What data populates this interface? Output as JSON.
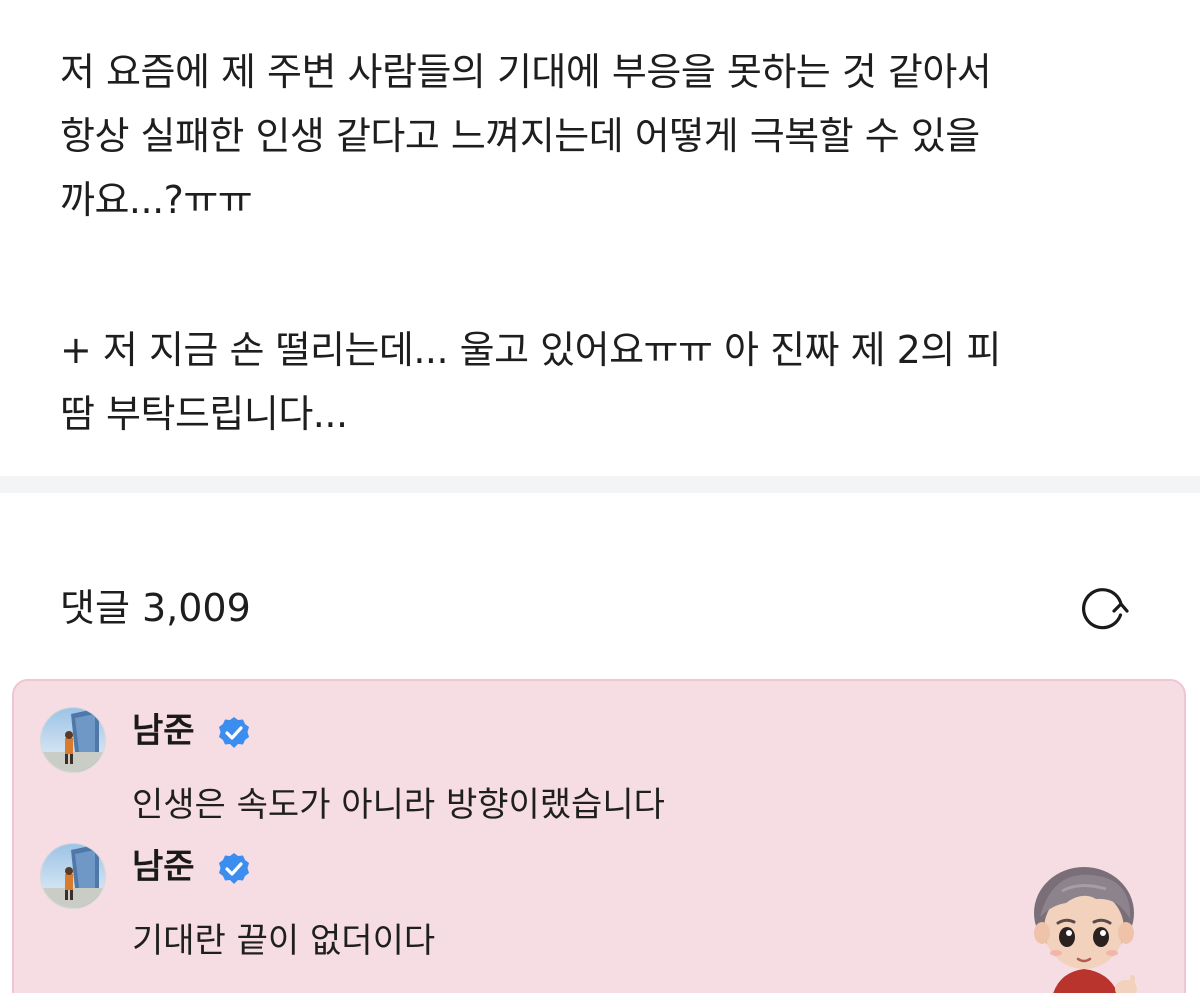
{
  "post": {
    "lines": [
      "저 요즘에 제 주변 사람들의 기대에 부응을 못하는 것 같아서",
      "항상 실패한 인생 같다고 느껴지는데 어떻게 극복할 수 있을",
      "까요...?ㅠㅠ",
      "+ 저 지금 손 떨리는데... 울고 있어요ㅠㅠ 아 진짜 제 2의 피",
      "땀 부탁드립니다..."
    ]
  },
  "comments_section": {
    "count_label": "댓글 3,009",
    "refresh_icon": "refresh-icon"
  },
  "comments": [
    {
      "author": "남준",
      "verified_icon": "verified-badge-icon",
      "text": "인생은 속도가 아니라 방향이랬습니다"
    },
    {
      "author": "남준",
      "verified_icon": "verified-badge-icon",
      "text": "기대란 끝이 없더이다"
    }
  ],
  "colors": {
    "comment_background": "#f6dde4",
    "comment_border": "#efc6d1",
    "verified_badge": "#3b8ef0",
    "separator": "#f3f4f6"
  }
}
